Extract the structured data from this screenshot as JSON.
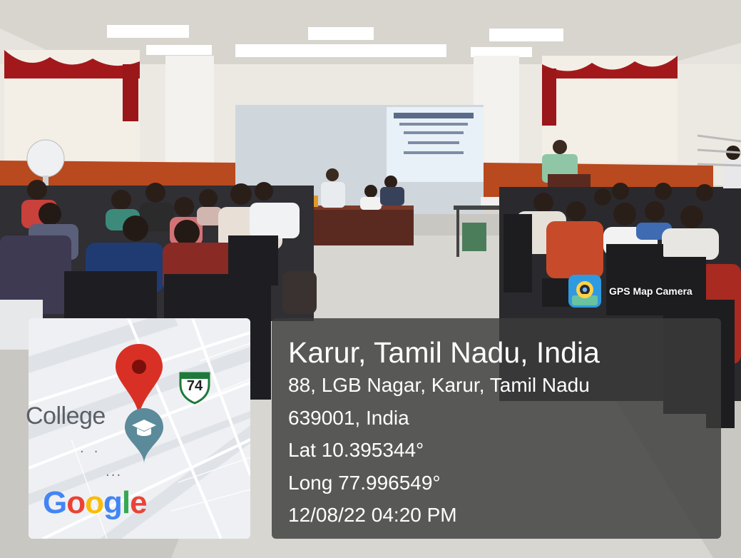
{
  "overlay": {
    "app_label": "GPS Map Camera",
    "app_icon": "gps-map-camera-icon"
  },
  "map": {
    "place_label": "College",
    "route_number": "74",
    "brand": "Google",
    "pin_icon": "map-pin-icon",
    "place_icon": "college-graduation-cap-icon"
  },
  "location": {
    "title": "Karur, Tamil Nadu, India",
    "address_line1": "88, LGB Nagar, Karur, Tamil Nadu",
    "address_line2": "639001, India",
    "latitude": "Lat 10.395344°",
    "longitude": "Long 77.996549°",
    "timestamp": "12/08/22 04:20 PM"
  },
  "colors": {
    "pin_red": "#d93025",
    "panel_bg": "#3c3c3c",
    "google_blue": "#4285f4",
    "google_red": "#ea4335",
    "google_yellow": "#fbbc05",
    "google_green": "#34a853"
  }
}
